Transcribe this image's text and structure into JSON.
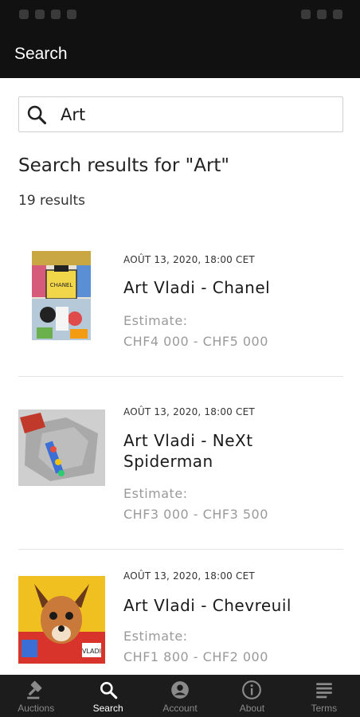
{
  "app_bar": {
    "title": "Search"
  },
  "search": {
    "value": "Art",
    "icon": "search-icon"
  },
  "results": {
    "heading": "Search results for \"Art\"",
    "count": "19 results"
  },
  "items": [
    {
      "date": "AOÛT 13, 2020, 18:00 CET",
      "name": "Art Vladi - Chanel",
      "estimate_label": "Estimate:",
      "estimate_value": "CHF4 000 - CHF5 000"
    },
    {
      "date": "AOÛT 13, 2020, 18:00 CET",
      "name": "Art Vladi - NeXt Spiderman",
      "estimate_label": "Estimate:",
      "estimate_value": "CHF3 000 - CHF3 500"
    },
    {
      "date": "AOÛT 13, 2020, 18:00 CET",
      "name": "Art Vladi - Chevreuil",
      "estimate_label": "Estimate:",
      "estimate_value": "CHF1 800 - CHF2 000"
    }
  ],
  "nav": [
    {
      "label": "Auctions",
      "icon": "gavel-icon",
      "active": false
    },
    {
      "label": "Search",
      "icon": "search-icon",
      "active": true
    },
    {
      "label": "Account",
      "icon": "account-icon",
      "active": false
    },
    {
      "label": "About",
      "icon": "info-icon",
      "active": false
    },
    {
      "label": "Terms",
      "icon": "document-icon",
      "active": false
    }
  ],
  "colors": {
    "bar": "#111111",
    "nav_bg": "#1c1c1c",
    "muted": "#9a9a9a"
  }
}
